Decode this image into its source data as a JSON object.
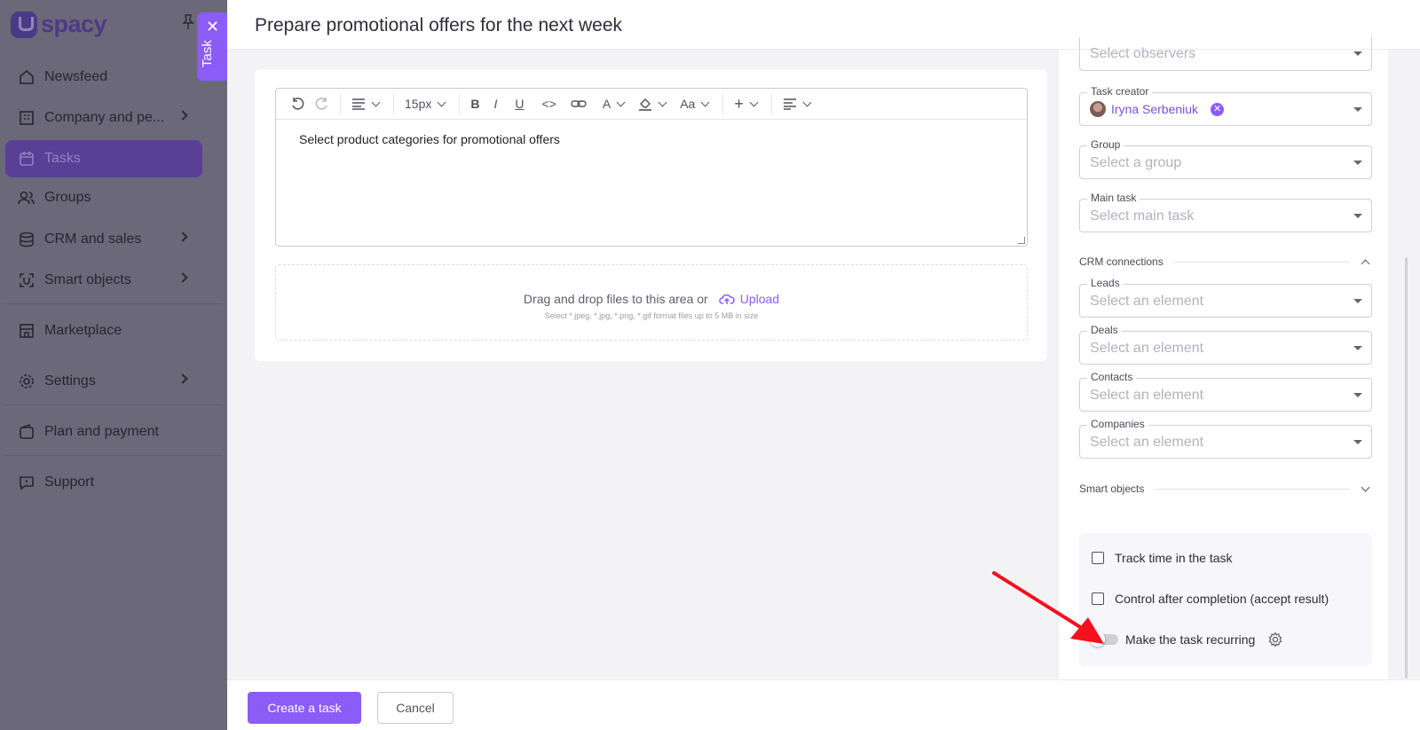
{
  "app": {
    "logo_text": "spacy",
    "logo_mark": "U"
  },
  "sidebar": {
    "items": [
      {
        "label": "Newsfeed",
        "icon": "home-icon"
      },
      {
        "label": "Company and pe...",
        "icon": "building-icon"
      },
      {
        "label": "Tasks",
        "icon": "calendar-icon",
        "active": true
      },
      {
        "label": "Groups",
        "icon": "users-icon"
      },
      {
        "label": "CRM and sales",
        "icon": "coins-icon"
      },
      {
        "label": "Smart objects",
        "icon": "smart-objects-icon"
      },
      {
        "label": "Marketplace",
        "icon": "store-icon"
      },
      {
        "label": "Settings",
        "icon": "gear-icon"
      },
      {
        "label": "Plan and payment",
        "icon": "wallet-icon"
      },
      {
        "label": "Support",
        "icon": "chat-icon"
      }
    ]
  },
  "task_tab": {
    "label": "Task",
    "close": "✕"
  },
  "header": {
    "title": "Prepare promotional offers for the next week"
  },
  "editor": {
    "font_size": "15px",
    "content": "Select  product categories for promotional offers",
    "toolbar_glyphs": {
      "bold": "B",
      "italic": "I",
      "underline": "U",
      "code": "<>",
      "font": "A",
      "case": "Aa",
      "plus": "+"
    }
  },
  "dropzone": {
    "text": "Drag and drop files to this area or",
    "upload_label": "Upload",
    "hint": "Select *.jpeg, *.jpg, *.png, *.gif format files up to 5 MB in size"
  },
  "right_panel": {
    "observers": {
      "placeholder": "Select observers"
    },
    "task_creator": {
      "label": "Task creator",
      "value": "Iryna Serbeniuk"
    },
    "group": {
      "label": "Group",
      "placeholder": "Select a group"
    },
    "main_task": {
      "label": "Main task",
      "placeholder": "Select main task"
    },
    "crm_section": "CRM connections",
    "leads": {
      "label": "Leads",
      "placeholder": "Select an element"
    },
    "deals": {
      "label": "Deals",
      "placeholder": "Select an element"
    },
    "contacts": {
      "label": "Contacts",
      "placeholder": "Select an element"
    },
    "companies": {
      "label": "Companies",
      "placeholder": "Select an element"
    },
    "smart_section": "Smart objects",
    "options": {
      "track_time": "Track time in the task",
      "control_after": "Control after completion (accept result)",
      "recurring": "Make the task recurring"
    }
  },
  "footer": {
    "create_label": "Create a task",
    "cancel_label": "Cancel"
  },
  "colors": {
    "accent": "#8b5cf6",
    "annotation_arrow": "#f5101e"
  }
}
